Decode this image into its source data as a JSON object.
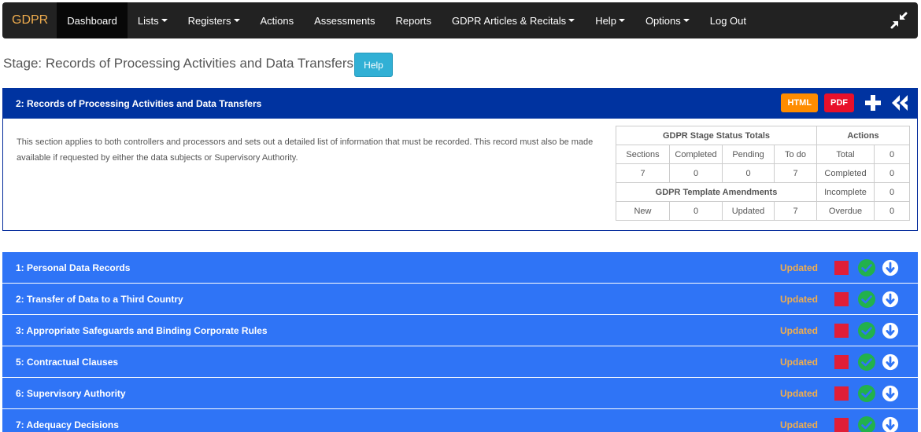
{
  "navbar": {
    "brand": "GDPR",
    "items": [
      {
        "label": "Dashboard",
        "dropdown": false,
        "active": true
      },
      {
        "label": "Lists",
        "dropdown": true
      },
      {
        "label": "Registers",
        "dropdown": true
      },
      {
        "label": "Actions",
        "dropdown": false
      },
      {
        "label": "Assessments",
        "dropdown": false
      },
      {
        "label": "Reports",
        "dropdown": false
      },
      {
        "label": "GDPR Articles & Recitals",
        "dropdown": true
      },
      {
        "label": "Help",
        "dropdown": true
      },
      {
        "label": "Options",
        "dropdown": true
      },
      {
        "label": "Log Out",
        "dropdown": false
      }
    ],
    "right_icon": "compress-icon"
  },
  "page": {
    "title": "Stage: Records of Processing Activities and Data Transfers",
    "help_label": "Help"
  },
  "panel": {
    "title": "2: Records of Processing Activities and Data Transfers",
    "html_label": "HTML",
    "pdf_label": "PDF",
    "add_icon": "plus-icon",
    "back_icon": "double-chevron-left-icon",
    "description": "This section applies to both controllers and processors and sets out a detailed list of information that must be recorded.  This record must also be made available if requested by either the data subjects or Supervisory Authority."
  },
  "status_table": {
    "stage_totals_header": "GDPR Stage Status Totals",
    "actions_header": "Actions",
    "sections_label": "Sections",
    "completed_label": "Completed",
    "pending_label": "Pending",
    "todo_label": "To do",
    "sections_value": "7",
    "completed_value": "0",
    "pending_value": "0",
    "todo_value": "7",
    "amendments_header": "GDPR Template Amendments",
    "new_label": "New",
    "new_value": "0",
    "updated_label": "Updated",
    "updated_value": "7",
    "actions_total_label": "Total",
    "actions_total_value": "0",
    "actions_completed_label": "Completed",
    "actions_completed_value": "0",
    "actions_incomplete_label": "Incomplete",
    "actions_incomplete_value": "0",
    "actions_overdue_label": "Overdue",
    "actions_overdue_value": "0"
  },
  "sections": [
    {
      "title": "1: Personal Data Records",
      "status": "Updated"
    },
    {
      "title": "2: Transfer of Data to a Third Country",
      "status": "Updated"
    },
    {
      "title": "3: Appropriate Safeguards and Binding Corporate Rules",
      "status": "Updated"
    },
    {
      "title": "5: Contractual Clauses",
      "status": "Updated"
    },
    {
      "title": "6: Supervisory Authority",
      "status": "Updated"
    },
    {
      "title": "7: Adequacy Decisions",
      "status": "Updated"
    }
  ],
  "colors": {
    "navbar_bg": "#222222",
    "brand": "#f0ad4e",
    "panel_header": "#0033a0",
    "section_row": "#2f74f6",
    "status_updated": "#f0ad4e",
    "pending_square": "#e01e37",
    "complete_check": "#22b14c",
    "html_badge": "#ff8c00",
    "pdf_badge": "#e8102a",
    "help_button": "#31b0d5"
  }
}
